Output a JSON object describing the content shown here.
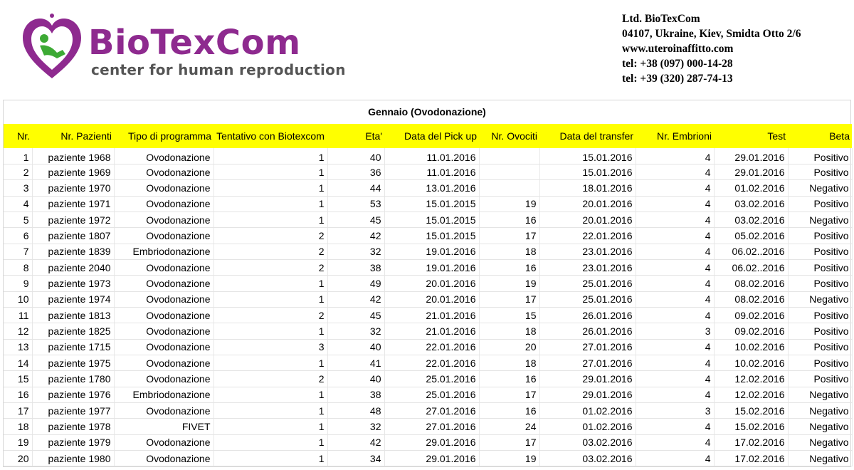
{
  "colors": {
    "brand": "#8e2a8f",
    "header_fill": "#ffff00",
    "logo_green": "#3daa35"
  },
  "logo": {
    "icon": "heart-figure-icon",
    "brand_name": "BioTexCom",
    "tagline": "center for human reproduction"
  },
  "contact": {
    "company": "Ltd. BioTexCom",
    "address": "04107, Ukraine, Kiev, Smidta Otto 2/6",
    "website": "www.uteroinaffitto.com",
    "tel1": "tel: +38 (097) 000-14-28",
    "tel2": "tel: +39 (320) 287-74-13"
  },
  "sheet": {
    "title": "Gennaio (Ovodonazione)",
    "columns": [
      "Nr.",
      "Nr. Pazienti",
      "Tipo di programma",
      "Tentativo con Biotexcom",
      "Eta'",
      "Data del Pick up",
      "Nr. Ovociti",
      "Data del transfer",
      "Nr. Embrioni",
      "Test",
      "Beta"
    ],
    "rows": [
      [
        "1",
        "paziente 1968",
        "Ovodonazione",
        "1",
        "40",
        "11.01.2016",
        "",
        "15.01.2016",
        "4",
        "29.01.2016",
        "Positivo"
      ],
      [
        "2",
        "paziente 1969",
        "Ovodonazione",
        "1",
        "36",
        "11.01.2016",
        "",
        "15.01.2016",
        "4",
        "29.01.2016",
        "Positivo"
      ],
      [
        "3",
        "paziente 1970",
        "Ovodonazione",
        "1",
        "44",
        "13.01.2016",
        "",
        "18.01.2016",
        "4",
        "01.02.2016",
        "Negativo"
      ],
      [
        "4",
        "paziente 1971",
        "Ovodonazione",
        "1",
        "53",
        "15.01.2015",
        "19",
        "20.01.2016",
        "4",
        "03.02.2016",
        "Positivo"
      ],
      [
        "5",
        "paziente 1972",
        "Ovodonazione",
        "1",
        "45",
        "15.01.2015",
        "16",
        "20.01.2016",
        "4",
        "03.02.2016",
        "Negativo"
      ],
      [
        "6",
        "paziente 1807",
        "Ovodonazione",
        "2",
        "42",
        "15.01.2015",
        "17",
        "22.01.2016",
        "4",
        "05.02.2016",
        "Positivo"
      ],
      [
        "7",
        "paziente 1839",
        "Embriodonazione",
        "2",
        "32",
        "19.01.2016",
        "18",
        "23.01.2016",
        "4",
        "06.02..2016",
        "Positivo"
      ],
      [
        "8",
        "paziente 2040",
        "Ovodonazione",
        "2",
        "38",
        "19.01.2016",
        "16",
        "23.01.2016",
        "4",
        "06.02..2016",
        "Positivo"
      ],
      [
        "9",
        "paziente 1973",
        "Ovodonazione",
        "1",
        "49",
        "20.01.2016",
        "19",
        "25.01.2016",
        "4",
        "08.02.2016",
        "Positivo"
      ],
      [
        "10",
        "paziente 1974",
        "Ovodonazione",
        "1",
        "42",
        "20.01.2016",
        "17",
        "25.01.2016",
        "4",
        "08.02.2016",
        "Negativo"
      ],
      [
        "11",
        "paziente 1813",
        "Ovodonazione",
        "2",
        "45",
        "21.01.2016",
        "15",
        "26.01.2016",
        "4",
        "09.02.2016",
        "Positivo"
      ],
      [
        "12",
        "paziente 1825",
        "Ovodonazione",
        "1",
        "32",
        "21.01.2016",
        "18",
        "26.01.2016",
        "3",
        "09.02.2016",
        "Positivo"
      ],
      [
        "13",
        "paziente 1715",
        "Ovodonazione",
        "3",
        "40",
        "22.01.2016",
        "20",
        "27.01.2016",
        "4",
        "10.02.2016",
        "Positivo"
      ],
      [
        "14",
        "paziente 1975",
        "Ovodonazione",
        "1",
        "41",
        "22.01.2016",
        "18",
        "27.01.2016",
        "4",
        "10.02.2016",
        "Positivo"
      ],
      [
        "15",
        "paziente 1780",
        "Ovodonazione",
        "2",
        "40",
        "25.01.2016",
        "16",
        "29.01.2016",
        "4",
        "12.02.2016",
        "Positivo"
      ],
      [
        "16",
        "paziente 1976",
        "Embriodonazione",
        "1",
        "38",
        "25.01.2016",
        "17",
        "29.01.2016",
        "4",
        "12.02.2016",
        "Negativo"
      ],
      [
        "17",
        "paziente 1977",
        "Ovodonazione",
        "1",
        "48",
        "27.01.2016",
        "16",
        "01.02.2016",
        "3",
        "15.02.2016",
        "Negativo"
      ],
      [
        "18",
        "paziente 1978",
        "FIVET",
        "1",
        "32",
        "27.01.2016",
        "24",
        "01.02.2016",
        "4",
        "15.02.2016",
        "Negativo"
      ],
      [
        "19",
        "paziente 1979",
        "Ovodonazione",
        "1",
        "42",
        "29.01.2016",
        "17",
        "03.02.2016",
        "4",
        "17.02.2016",
        "Negativo"
      ],
      [
        "20",
        "paziente 1980",
        "Ovodonazione",
        "1",
        "34",
        "29.01.2016",
        "19",
        "03.02.2016",
        "4",
        "17.02.2016",
        "Negativo"
      ]
    ]
  }
}
